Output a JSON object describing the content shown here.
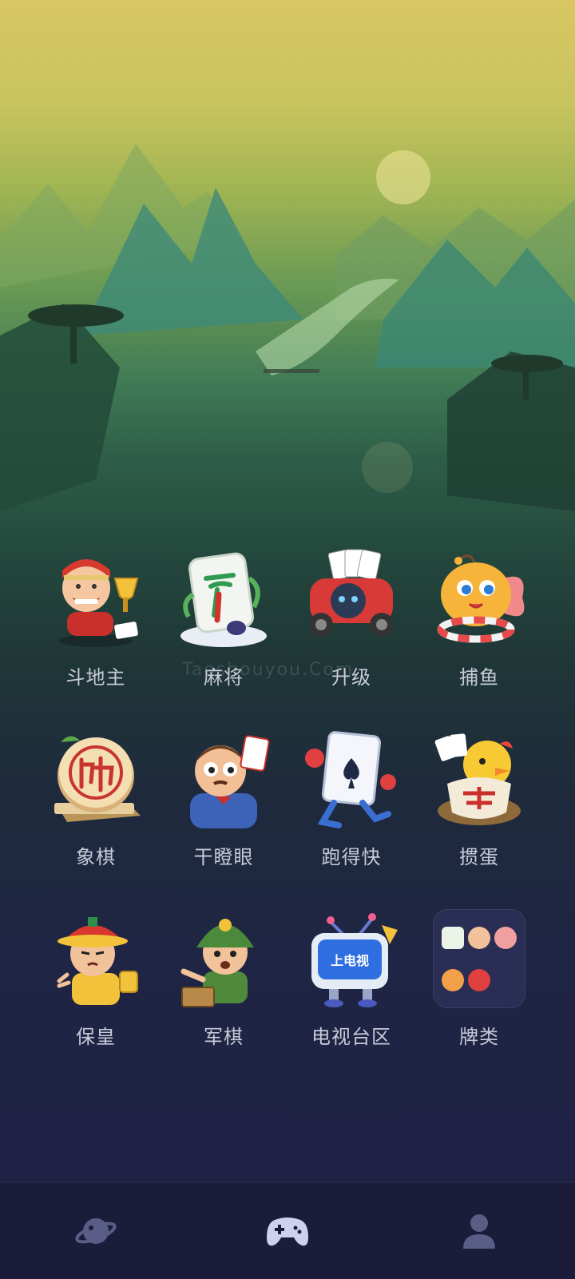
{
  "games": {
    "row1": [
      {
        "label": "斗地主",
        "icon": "landlord-character-icon"
      },
      {
        "label": "麻将",
        "icon": "mahjong-tile-icon"
      },
      {
        "label": "升级",
        "icon": "card-car-icon"
      },
      {
        "label": "捕鱼",
        "icon": "goldfish-icon"
      }
    ],
    "row2": [
      {
        "label": "象棋",
        "icon": "chinese-chess-piece-icon"
      },
      {
        "label": "干瞪眼",
        "icon": "staring-man-icon"
      },
      {
        "label": "跑得快",
        "icon": "running-card-icon"
      },
      {
        "label": "掼蛋",
        "icon": "chick-egg-icon"
      }
    ],
    "row3": [
      {
        "label": "保皇",
        "icon": "emperor-character-icon"
      },
      {
        "label": "军棋",
        "icon": "soldier-character-icon"
      },
      {
        "label": "电视台区",
        "icon": "tv-character-icon"
      },
      {
        "label": "牌类",
        "icon": "card-games-folder-icon"
      }
    ]
  },
  "tv_screen_text": "上电视",
  "watermark": "Taoshouyou.Com",
  "tabbar": {
    "items": [
      "planet-icon",
      "gamepad-icon",
      "profile-icon"
    ],
    "active": "gamepad-icon"
  },
  "colors": {
    "label": "#c7cbd8",
    "tabbar_bg": "#1b1c3a",
    "accent": "#cfd0f0"
  }
}
